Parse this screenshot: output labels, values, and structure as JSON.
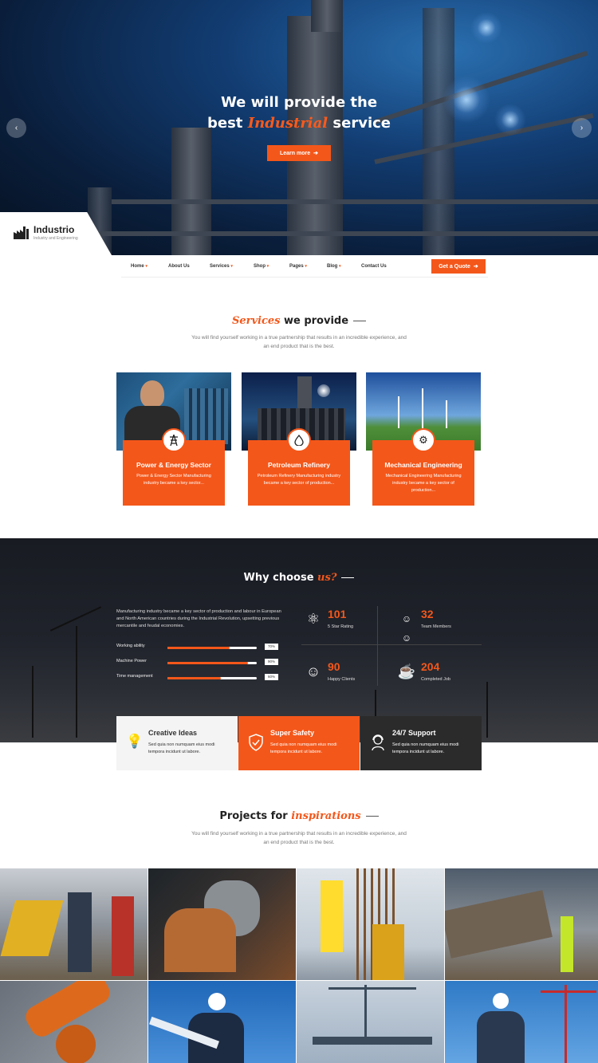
{
  "hero": {
    "title_line1": "We will provide the",
    "title_pre": "best ",
    "title_accent": "Industrial",
    "title_post": " service",
    "button_label": "Learn more",
    "prev_arrow": "‹",
    "next_arrow": "›"
  },
  "brand": {
    "name": "Industrio",
    "tagline": "Industry and Engineering"
  },
  "nav": {
    "items": [
      {
        "label": "Home",
        "dropdown": true
      },
      {
        "label": "About Us",
        "dropdown": false
      },
      {
        "label": "Services",
        "dropdown": true
      },
      {
        "label": "Shop",
        "dropdown": true
      },
      {
        "label": "Pages",
        "dropdown": true
      },
      {
        "label": "Blog",
        "dropdown": true
      },
      {
        "label": "Contact Us",
        "dropdown": false
      }
    ],
    "caret": "▾",
    "quote_label": "Get a Quote"
  },
  "services": {
    "title_accent": "Services",
    "title_rest": " we provide",
    "subtitle": "You will find yourself working in a true partnership that results in an incredible experience, and an end product that is the best.",
    "cards": [
      {
        "title": "Power & Energy Sector",
        "desc": "Power & Energy Sector Manufacturing industry became a key sector...",
        "icon": "power-tower-icon"
      },
      {
        "title": "Petroleum Refinery",
        "desc": "Petroleum Refinery Manufacturing industry became a key sector of production...",
        "icon": "oil-drop-icon"
      },
      {
        "title": "Mechanical Engineering",
        "desc": "Mechanical Engineering Manufacturing industry became a key sector of production...",
        "icon": "gear-icon"
      }
    ]
  },
  "why": {
    "title": "Why choose ",
    "title_accent": "us?",
    "text": "Manufacturing industry became a key sector of production and labour in European and North American countries during the Industrial Revolution, upsetting previous mercantile and feudal economies.",
    "skills": [
      {
        "label": "Working ability",
        "percent": 70,
        "percent_label": "70%"
      },
      {
        "label": "Machine Power",
        "percent": 90,
        "percent_label": "90%"
      },
      {
        "label": "Time management",
        "percent": 60,
        "percent_label": "60%"
      }
    ],
    "stats": [
      {
        "number": "101",
        "label": "5 Star Rating",
        "icon": "atom-icon"
      },
      {
        "number": "32",
        "label": "Team Members",
        "icon": "team-icon"
      },
      {
        "number": "90",
        "label": "Happy Clients",
        "icon": "client-icon"
      },
      {
        "number": "204",
        "label": "Completed Job",
        "icon": "coffee-cup-icon"
      }
    ]
  },
  "features": [
    {
      "title": "Creative Ideas",
      "desc": "Sed quia non numquam eius modi tempora incidunt ut labore.",
      "icon": "lightbulb-icon"
    },
    {
      "title": "Super Safety",
      "desc": "Sed quia non numquam eius modi tempora incidunt ut labore.",
      "icon": "shield-check-icon"
    },
    {
      "title": "24/7 Support",
      "desc": "Sed quia non numquam eius modi tempora incidunt ut labore.",
      "icon": "support-agent-icon"
    }
  ],
  "projects": {
    "title": "Projects for ",
    "title_accent": "inspirations",
    "subtitle": "You will find yourself working in a true partnership that results in an incredible experience, and an end product that is the best."
  },
  "colors": {
    "accent": "#f4571a",
    "dark": "#1e2128",
    "feature_dark": "#2b2b2b",
    "feature_light": "#f4f4f4"
  }
}
